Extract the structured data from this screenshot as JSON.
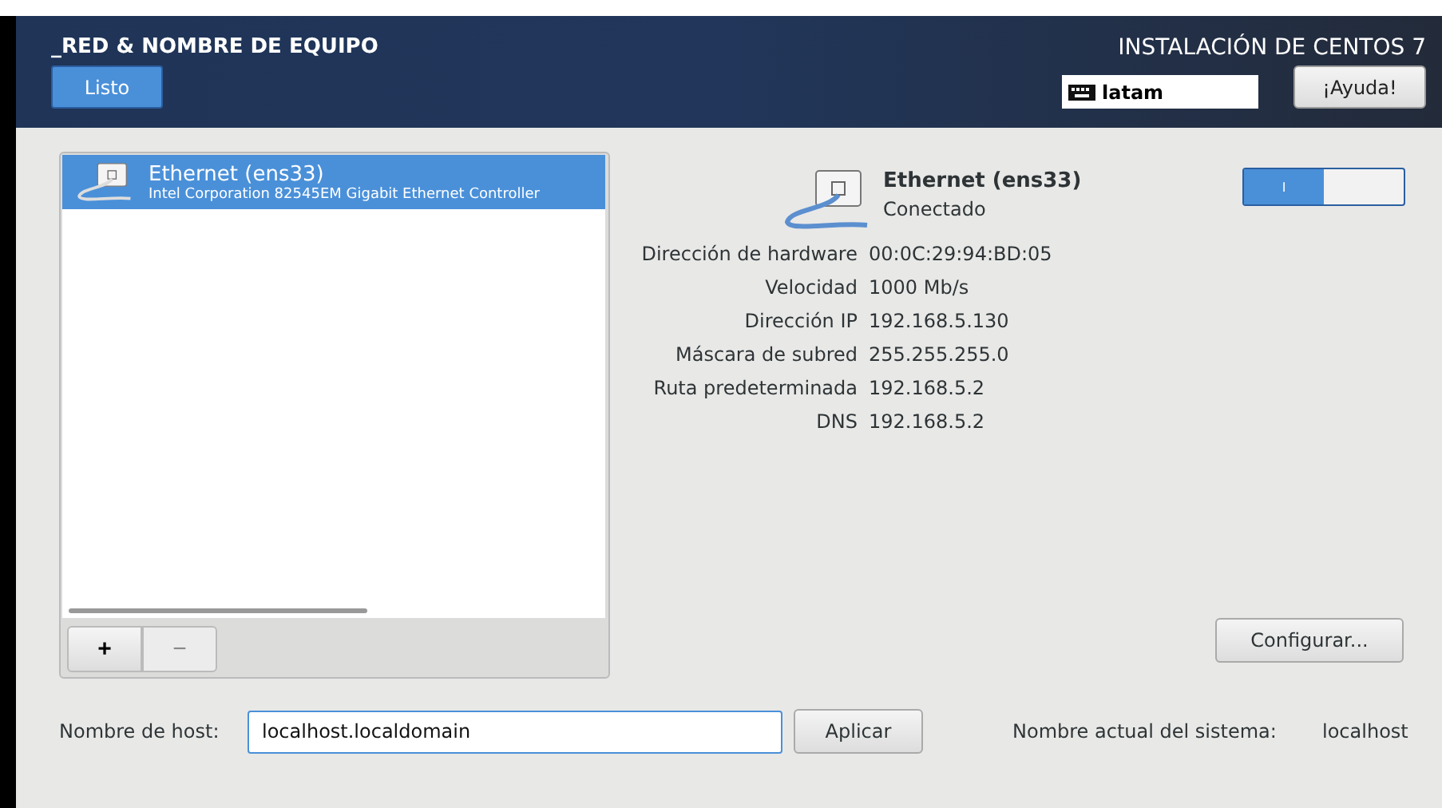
{
  "header": {
    "title": "_RED & NOMBRE DE EQUIPO",
    "done_button": "Listo",
    "product": "INSTALACIÓN DE CENTOS 7",
    "keyboard_layout": "latam",
    "help_button": "¡Ayuda!"
  },
  "devices": [
    {
      "name": "Ethernet (ens33)",
      "description": "Intel Corporation 82545EM Gigabit Ethernet Controller",
      "selected": true
    }
  ],
  "list_buttons": [
    "+",
    "−"
  ],
  "details": {
    "name": "Ethernet (ens33)",
    "status": "Conectado",
    "switch": {
      "on": true,
      "on_label": "I"
    },
    "rows": [
      {
        "label": "Dirección de hardware",
        "value": "00:0C:29:94:BD:05"
      },
      {
        "label": "Velocidad",
        "value": "1000 Mb/s"
      },
      {
        "label": "Dirección IP",
        "value": "192.168.5.130"
      },
      {
        "label": "Máscara de subred",
        "value": "255.255.255.0"
      },
      {
        "label": "Ruta predeterminada",
        "value": "192.168.5.2"
      },
      {
        "label": "DNS",
        "value": "192.168.5.2"
      }
    ],
    "configure_button": "Configurar..."
  },
  "hostname": {
    "label": "Nombre de host:",
    "value": "localhost.localdomain",
    "apply_button": "Aplicar",
    "current_label": "Nombre actual del sistema:",
    "current_value": "localhost"
  }
}
